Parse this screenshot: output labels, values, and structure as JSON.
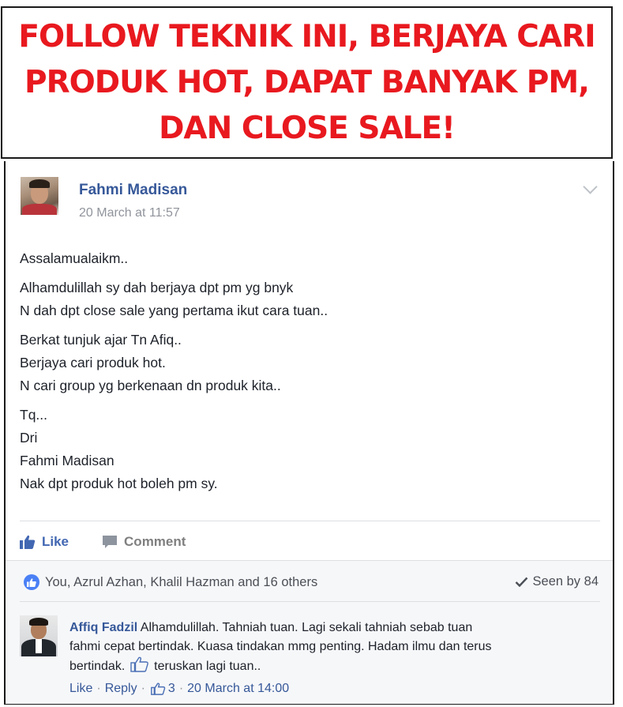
{
  "banner": {
    "lines": [
      "FOLLOW TEKNIK INI, BERJAYA CARI",
      "PRODUK HOT, DAPAT BANYAK PM,",
      "DAN CLOSE SALE!"
    ],
    "color": "#e8191f"
  },
  "post": {
    "author": "Fahmi Madisan",
    "timestamp": "20 March at 11:57",
    "paragraphs": [
      [
        "Assalamualaikm.."
      ],
      [
        "Alhamdulillah sy dah berjaya dpt pm yg bnyk",
        "N dah dpt close sale yang pertama ikut cara tuan.."
      ],
      [
        "Berkat tunjuk ajar Tn Afiq..",
        "Berjaya cari produk hot.",
        "N cari group yg berkenaan dn produk kita.."
      ],
      [
        "Tq...",
        "Dri",
        "Fahmi Madisan",
        "Nak dpt produk hot boleh pm sy."
      ]
    ],
    "actions": {
      "like": "Like",
      "comment": "Comment"
    },
    "reactions_text": "You, Azrul Azhan, Khalil Hazman and 16 others",
    "seen_text": "Seen by 84"
  },
  "comment": {
    "author": "Affiq Fadzil",
    "line1": "Alhamdulillah. Tahniah tuan. Lagi sekali tahniah sebab tuan",
    "line2": "fahmi cepat bertindak. Kuasa tindakan mmg penting. Hadam ilmu dan terus",
    "line3_before": "bertindak.",
    "line3_after": "teruskan lagi tuan..",
    "like_label": "Like",
    "reply_label": "Reply",
    "like_count": "3",
    "time": "20 March at 14:00"
  },
  "icons": {
    "more": "chevron-down-icon",
    "like": "thumbs-up-icon",
    "comment": "speech-bubble-icon",
    "seen": "checkmark-icon"
  },
  "colors": {
    "link": "#365899",
    "like_blue": "#4267b2"
  }
}
